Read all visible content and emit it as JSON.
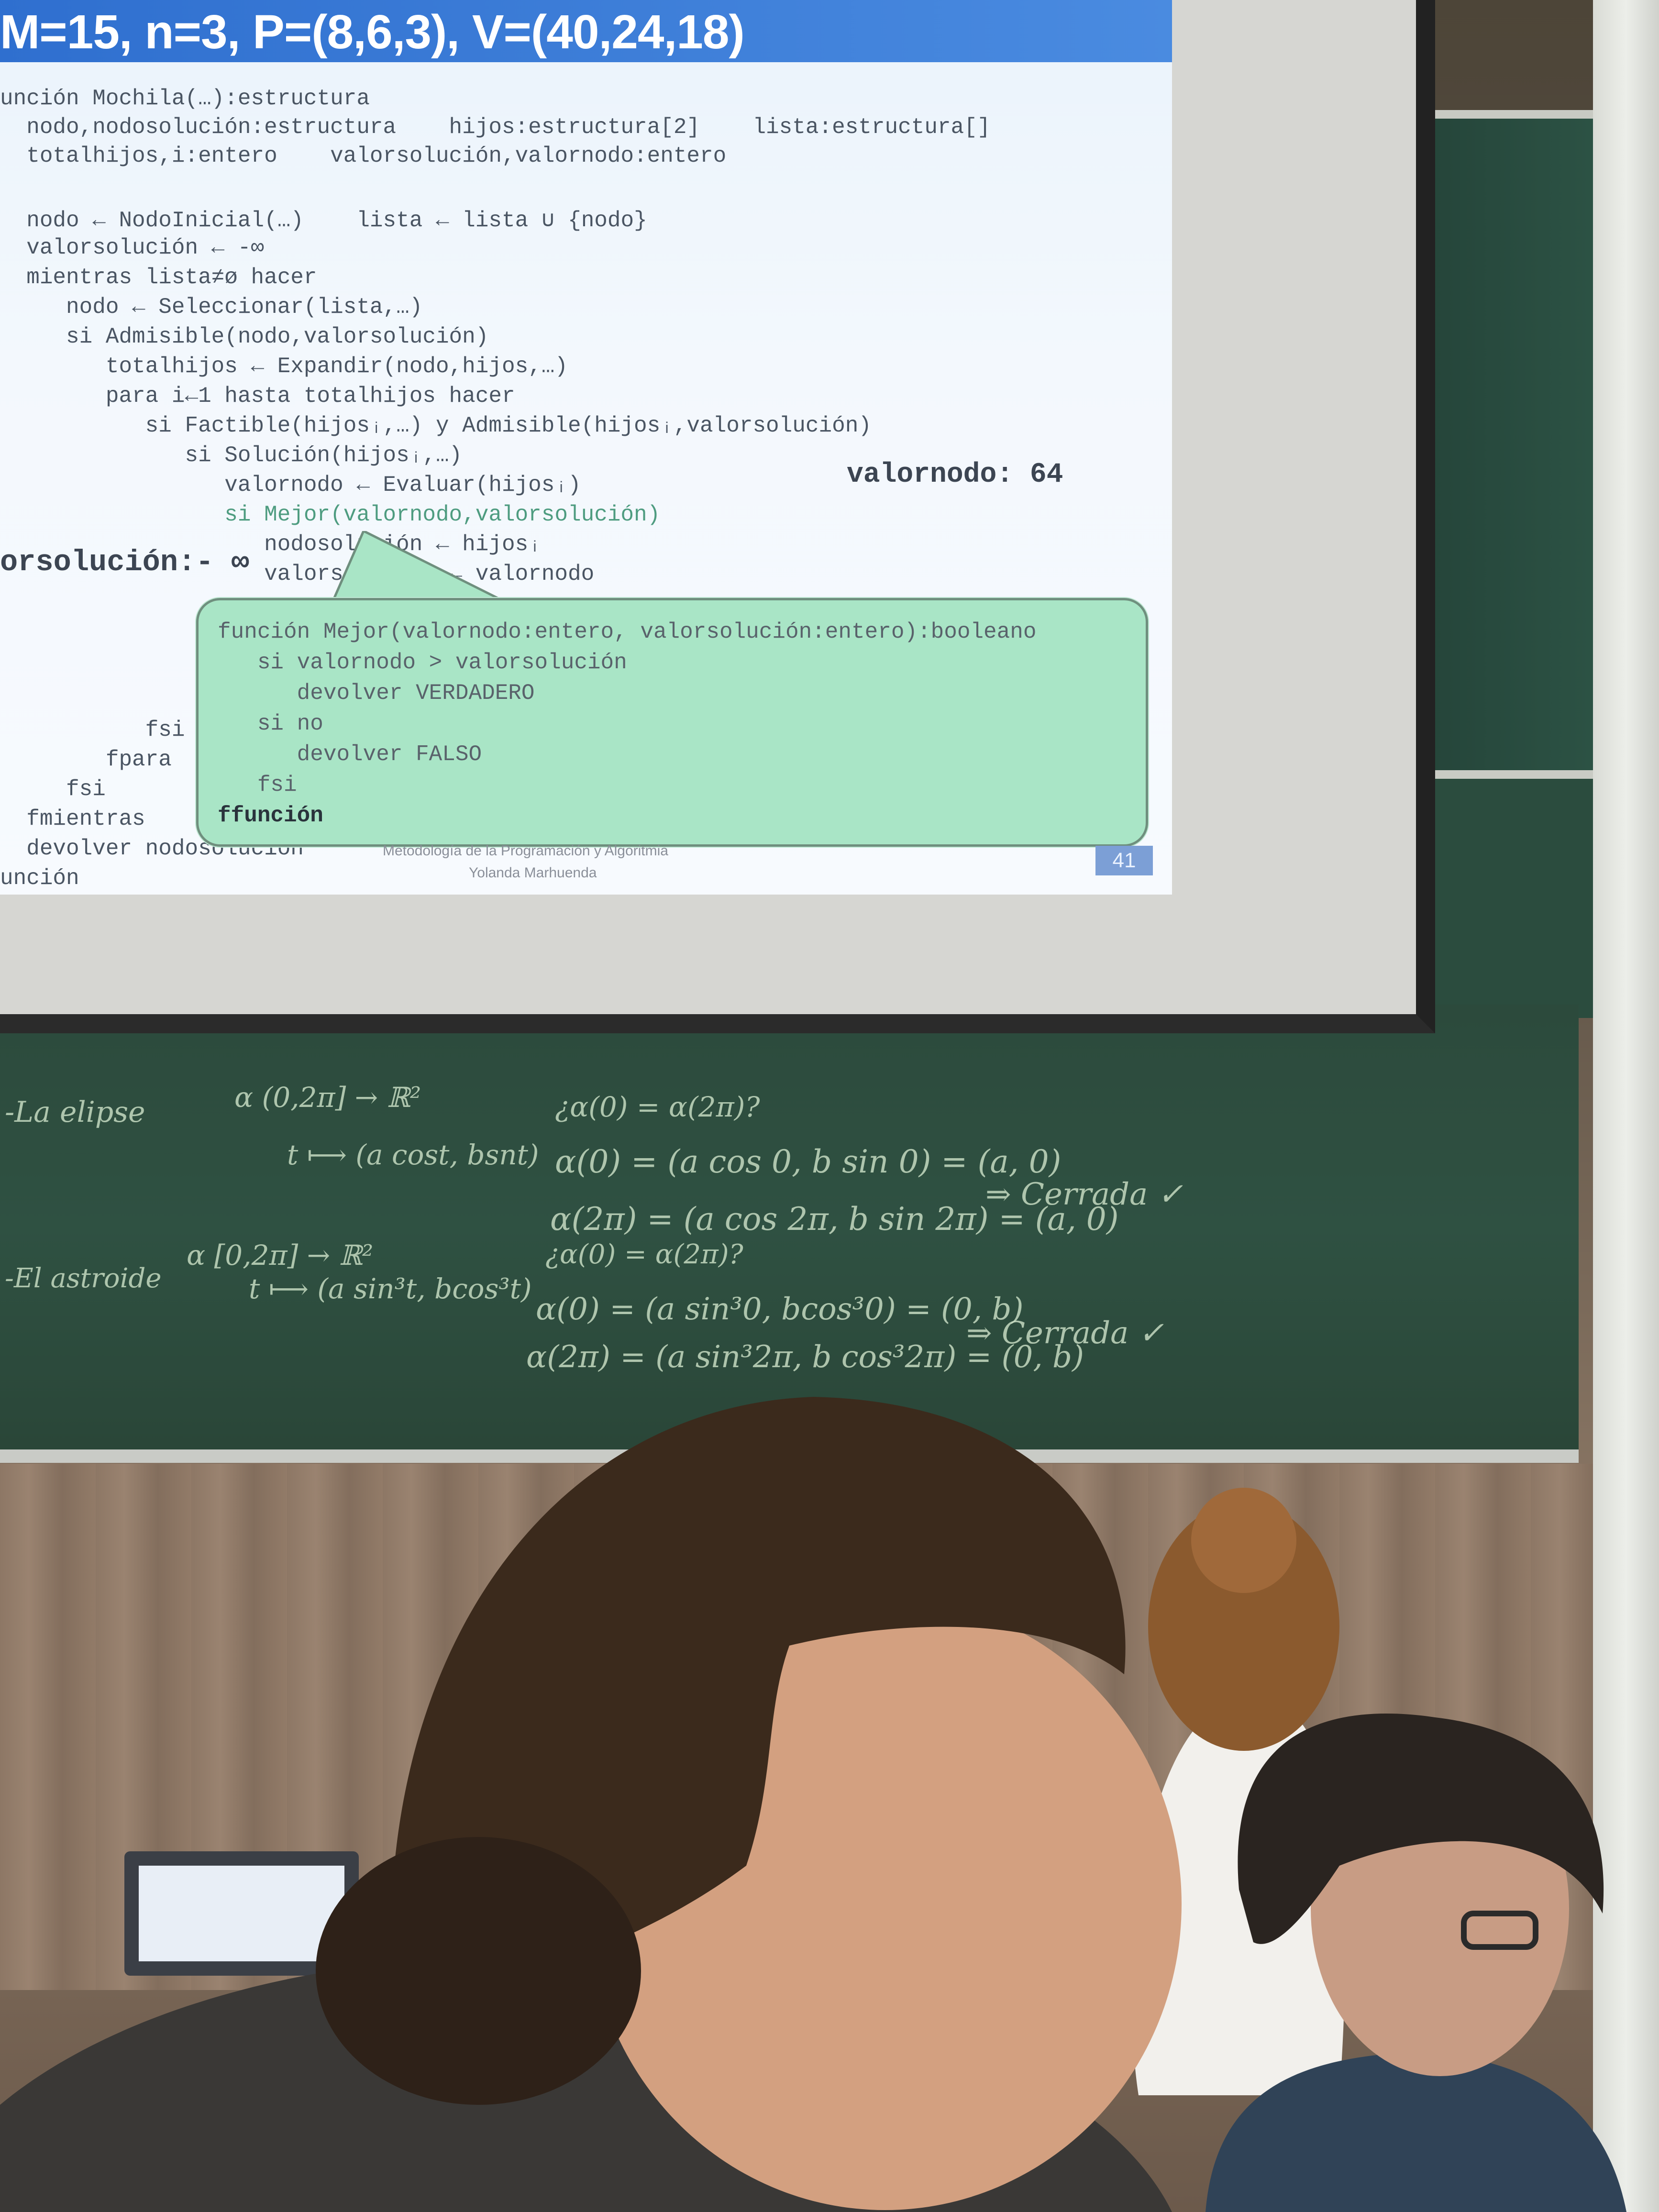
{
  "slide": {
    "title": "M=15, n=3, P=(8,6,3), V=(40,24,18)",
    "code_lines": [
      "unción Mochila(…):estructura",
      "  nodo,nodosolución:estructura    hijos:estructura[2]    lista:estructura[]",
      "  totalhijos,i:entero    valorsolución,valornodo:entero",
      "",
      "  nodo ← NodoInicial(…)    lista ← lista ∪ {nodo}",
      "  valorsolución ← -∞",
      "  mientras lista≠ø hacer",
      "     nodo ← Seleccionar(lista,…)",
      "     si Admisible(nodo,valorsolución)",
      "        totalhijos ← Expandir(nodo,hijos,…)",
      "        para i←1 hasta totalhijos hacer",
      "           si Factible(hijosᵢ,…) y Admisible(hijosᵢ,valorsolución)",
      "              si Solución(hijosᵢ,…)",
      "                 valornodo ← Evaluar(hijosᵢ)",
      "                 si Mejor(valornodo,valorsolución)",
      "                    nodosolución ← hijosᵢ",
      "                    valorsolución ← valornodo"
    ],
    "bottom_lines": [
      "           fsi",
      "        fpara",
      "     fsi",
      "  fmientras",
      "  devolver nodosolución",
      "unción"
    ],
    "valornodo_label": "valornodo: 64",
    "valorsolucion_label": "orsolución:- ∞",
    "footer_course": "Metodología de la Programación y Algoritmia",
    "footer_author": "Yolanda Marhuenda",
    "page_number": "41",
    "callout_lines": [
      "función Mejor(valornodo:entero, valorsolución:entero):booleano",
      "   si valornodo > valorsolución",
      "      devolver VERDADERO",
      "   si no",
      "      devolver FALSO",
      "   fsi",
      "ffunción"
    ]
  },
  "chalkboard": {
    "lines": [
      "-La elipse",
      "α (0,2π] → ℝ²",
      "t ⟼ (a cost, bsnt)",
      "¿α(0) = α(2π)?",
      "α(0) = (a cos 0, b sin 0) = (a, 0)",
      "α(2π) = (a cos 2π, b sin 2π) = (a, 0)",
      "⇒ Cerrada ✓",
      "-El astroide",
      "α [0,2π] → ℝ²",
      "t ⟼ (a sin³t, bcos³t)",
      "¿α(0) = α(2π)?",
      "α(0) = (a sin³0, bcos³0) = (0, b)",
      "α(2π) = (a sin³2π, b cos³2π) = (0, b)",
      "⇒ Cerrada ✓"
    ]
  },
  "colors": {
    "slide_header": "#2f6fcf",
    "callout": "#a9e5c6",
    "chalkboard": "#2f5142"
  }
}
